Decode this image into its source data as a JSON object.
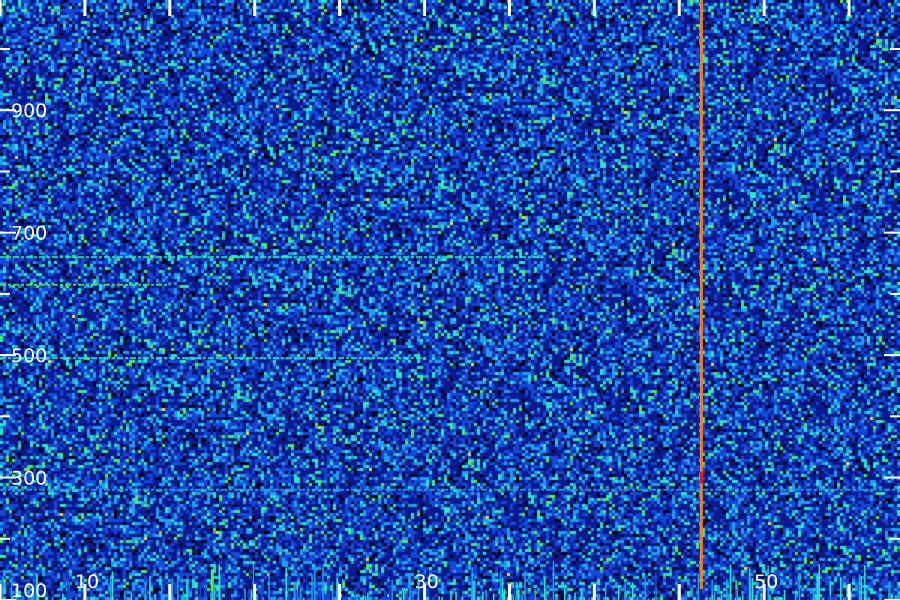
{
  "chart_data": {
    "type": "heatmap",
    "title": "",
    "xlabel": "",
    "ylabel": "",
    "xlim": [
      5,
      58
    ],
    "ylim": [
      100,
      1080
    ],
    "x_ticks": [
      10,
      30,
      50
    ],
    "y_ticks": [
      100,
      300,
      500,
      700,
      900
    ],
    "x_tick_labels": [
      "10",
      "30",
      "50"
    ],
    "y_tick_labels": [
      "100",
      "300",
      "500",
      "700",
      "900"
    ],
    "colormap": [
      "#000018",
      "#0a1a8c",
      "#1448d8",
      "#1ea0f0",
      "#28e6c8",
      "#50f050",
      "#f0e030",
      "#f08020",
      "#e81818"
    ],
    "background_level": 0.3,
    "features": [
      {
        "kind": "vertical-line",
        "x": 46.3,
        "y_range": [
          118,
          1080
        ],
        "intensity": 0.85
      },
      {
        "kind": "vertical-line",
        "x": 46.3,
        "y_range": [
          290,
          310
        ],
        "intensity": 1.0
      },
      {
        "kind": "horizontal-line",
        "y": 660,
        "x_range": [
          5,
          37
        ],
        "intensity": 0.55
      },
      {
        "kind": "horizontal-line",
        "y": 615,
        "x_range": [
          5,
          15
        ],
        "intensity": 0.6
      },
      {
        "kind": "horizontal-line",
        "y": 495,
        "x_range": [
          5,
          30
        ],
        "intensity": 0.55
      },
      {
        "kind": "horizontal-line",
        "y": 280,
        "x_range": [
          5,
          58
        ],
        "intensity": 0.4
      },
      {
        "kind": "vertical-line",
        "x": 17.5,
        "y_range": [
          100,
          150
        ],
        "intensity": 0.6
      },
      {
        "kind": "bottom-band",
        "y_range": [
          100,
          170
        ],
        "intensity": 0.45
      }
    ]
  }
}
